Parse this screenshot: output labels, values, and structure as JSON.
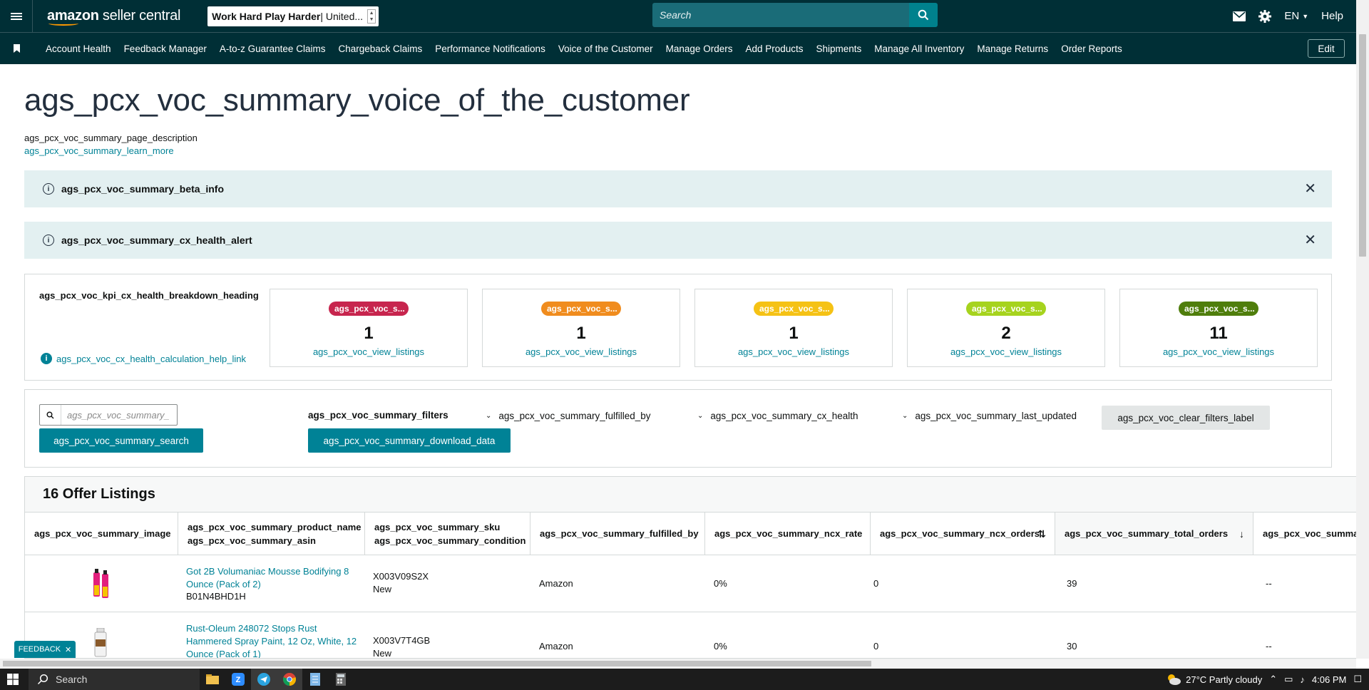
{
  "topbar": {
    "logo_bold": "amazon",
    "logo_light": " seller central",
    "account": "Work Hard Play Harder",
    "account_suffix": " | United...",
    "search_placeholder": "Search",
    "language": "EN",
    "help": "Help"
  },
  "nav": {
    "items": [
      "Account Health",
      "Feedback Manager",
      "A-to-z Guarantee Claims",
      "Chargeback Claims",
      "Performance Notifications",
      "Voice of the Customer",
      "Manage Orders",
      "Add Products",
      "Shipments",
      "Manage All Inventory",
      "Manage Returns",
      "Order Reports"
    ],
    "edit": "Edit"
  },
  "page": {
    "title": "ags_pcx_voc_summary_voice_of_the_customer",
    "description": "ags_pcx_voc_summary_page_description",
    "learn_more": "ags_pcx_voc_summary_learn_more"
  },
  "alerts": {
    "beta": "ags_pcx_voc_summary_beta_info",
    "health": "ags_pcx_voc_summary_cx_health_alert"
  },
  "kpi": {
    "heading": "ags_pcx_voc_kpi_cx_health_breakdown_heading",
    "help_link": "ags_pcx_voc_cx_health_calculation_help_link",
    "cards": [
      {
        "badge": "ags_pcx_voc_s...",
        "count": "1",
        "link": "ags_pcx_voc_view_listings",
        "color": "#c7254e"
      },
      {
        "badge": "ags_pcx_voc_s...",
        "count": "1",
        "link": "ags_pcx_voc_view_listings",
        "color": "#f08c1e"
      },
      {
        "badge": "ags_pcx_voc_s...",
        "count": "1",
        "link": "ags_pcx_voc_view_listings",
        "color": "#f5c215"
      },
      {
        "badge": "ags_pcx_voc_s...",
        "count": "2",
        "link": "ags_pcx_voc_view_listings",
        "color": "#a6d31e"
      },
      {
        "badge": "ags_pcx_voc_s...",
        "count": "11",
        "link": "ags_pcx_voc_view_listings",
        "color": "#4f7e0c"
      }
    ]
  },
  "filters": {
    "search_placeholder": "ags_pcx_voc_summary_",
    "search_button": "ags_pcx_voc_summary_search",
    "label": "ags_pcx_voc_summary_filters",
    "download": "ags_pcx_voc_summary_download_data",
    "fulfilled_by": "ags_pcx_voc_summary_fulfilled_by",
    "cx_health": "ags_pcx_voc_summary_cx_health",
    "last_updated": "ags_pcx_voc_summary_last_updated",
    "clear": "ags_pcx_voc_clear_filters_label"
  },
  "table": {
    "title": "16 Offer Listings",
    "columns": {
      "image": "ags_pcx_voc_summary_image",
      "product_name": "ags_pcx_voc_summary_product_name",
      "asin": "ags_pcx_voc_summary_asin",
      "sku": "ags_pcx_voc_summary_sku",
      "condition": "ags_pcx_voc_summary_condition",
      "fulfilled_by": "ags_pcx_voc_summary_fulfilled_by",
      "ncx_rate": "ags_pcx_voc_summary_ncx_rate",
      "ncx_orders": "ags_pcx_voc_summary_ncx_orders",
      "total_orders": "ags_pcx_voc_summary_total_orders",
      "next": "ags_pcx_voc_summar"
    },
    "rows": [
      {
        "name": "Got 2B Volumaniac Mousse Bodifying 8 Ounce (Pack of 2)",
        "asin": "B01N4BHD1H",
        "sku": "X003V09S2X",
        "condition": "New",
        "fulfilled_by": "Amazon",
        "ncx_rate": "0%",
        "ncx_orders": "0",
        "total_orders": "39",
        "next": "--"
      },
      {
        "name": "Rust-Oleum 248072 Stops Rust Hammered Spray Paint, 12 Oz, White, 12 Ounce (Pack of 1)",
        "asin": "",
        "sku": "X003V7T4GB",
        "condition": "New",
        "fulfilled_by": "Amazon",
        "ncx_rate": "0%",
        "ncx_orders": "0",
        "total_orders": "30",
        "next": "--"
      }
    ]
  },
  "feedback": "FEEDBACK",
  "taskbar": {
    "search": "Search",
    "weather": "27°C  Partly cloudy",
    "time": "4:06 PM"
  }
}
